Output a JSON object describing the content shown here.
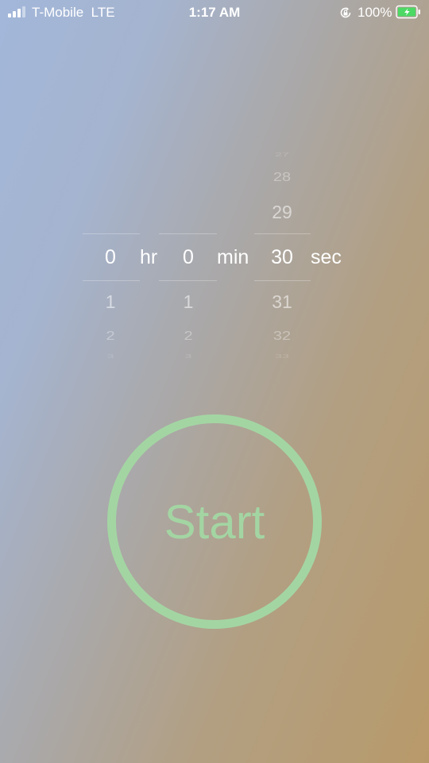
{
  "status_bar": {
    "carrier": "T-Mobile",
    "network": "LTE",
    "time": "1:17 AM",
    "battery_percent": "100%",
    "signal_bars_active": 3,
    "icons": [
      "signal-icon",
      "orientation-lock-icon",
      "battery-charging-icon"
    ]
  },
  "picker": {
    "hours": {
      "above": [],
      "selected": "0",
      "below": [
        "1",
        "2",
        "3"
      ],
      "unit": "hr"
    },
    "minutes": {
      "above": [],
      "selected": "0",
      "below": [
        "1",
        "2",
        "3"
      ],
      "unit": "min"
    },
    "seconds": {
      "above": [
        "27",
        "28",
        "29"
      ],
      "selected": "30",
      "below": [
        "31",
        "32",
        "33"
      ],
      "unit": "sec"
    }
  },
  "start_button": {
    "label": "Start"
  },
  "colors": {
    "accent": "#a3d5a3",
    "text": "#ffffff",
    "battery_fill": "#4cd964"
  }
}
